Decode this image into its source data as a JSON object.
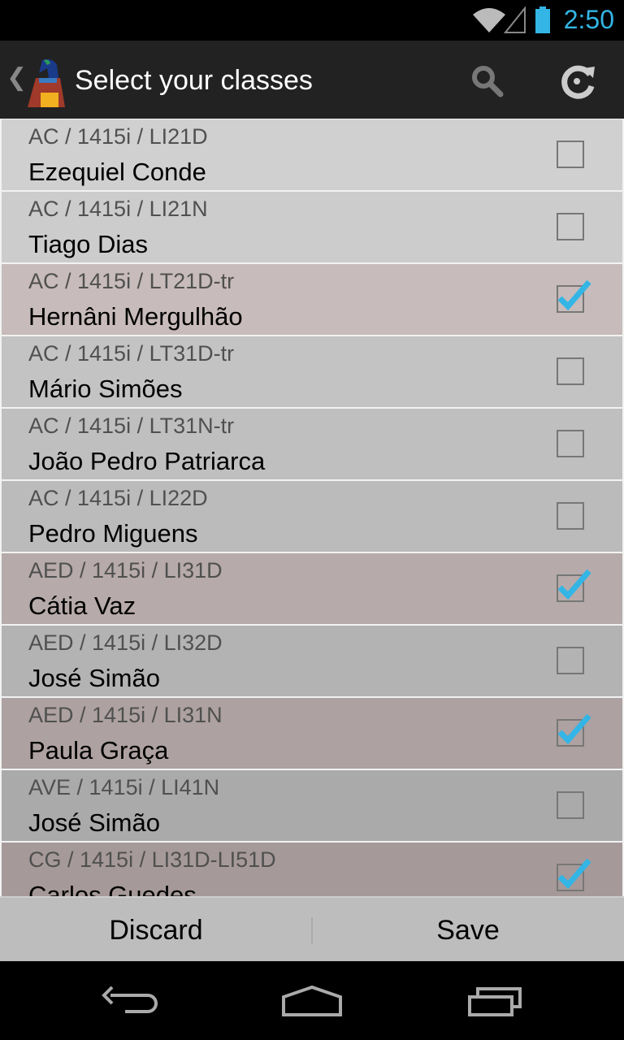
{
  "status_bar": {
    "time": "2:50",
    "accent": "#33b5e5"
  },
  "action_bar": {
    "title": "Select your classes",
    "icons": [
      "back-chevron-icon",
      "app-logo-icon",
      "search-icon",
      "refresh-icon"
    ]
  },
  "classes": [
    {
      "code": "AC / 1415i / LI21D",
      "teacher": "Ezequiel Conde",
      "checked": false
    },
    {
      "code": "AC / 1415i / LI21N",
      "teacher": "Tiago Dias",
      "checked": false
    },
    {
      "code": "AC / 1415i / LT21D-tr",
      "teacher": "Hernâni Mergulhão",
      "checked": true
    },
    {
      "code": "AC / 1415i / LT31D-tr",
      "teacher": "Mário Simões",
      "checked": false
    },
    {
      "code": "AC / 1415i / LT31N-tr",
      "teacher": "João Pedro Patriarca",
      "checked": false
    },
    {
      "code": "AC / 1415i / LI22D",
      "teacher": "Pedro Miguens",
      "checked": false
    },
    {
      "code": "AED / 1415i / LI31D",
      "teacher": "Cátia Vaz",
      "checked": true
    },
    {
      "code": "AED / 1415i / LI32D",
      "teacher": "José Simão",
      "checked": false
    },
    {
      "code": "AED / 1415i / LI31N",
      "teacher": "Paula Graça",
      "checked": true
    },
    {
      "code": "AVE / 1415i / LI41N",
      "teacher": "José Simão",
      "checked": false
    },
    {
      "code": "CG / 1415i / LI31D-LI51D",
      "teacher": "Carlos Guedes",
      "checked": true
    }
  ],
  "bottom_bar": {
    "discard": "Discard",
    "save": "Save"
  },
  "nav_bar": {
    "icons": [
      "back-icon",
      "home-icon",
      "recents-icon"
    ]
  }
}
